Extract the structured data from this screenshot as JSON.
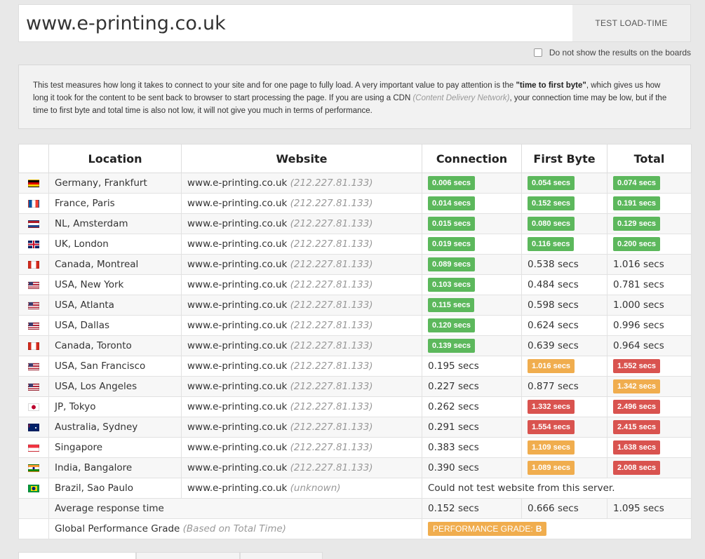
{
  "search": {
    "url_value": "www.e-printing.co.uk",
    "button_label": "TEST LOAD-TIME"
  },
  "options": {
    "hide_label": "Do not show the results on the boards"
  },
  "info": {
    "part1": "This test measures how long it takes to connect to your site and for one page to fully load. A very important value to pay attention is the ",
    "bold": "\"time to first byte\"",
    "part2": ", which gives us how long it took for the content to be sent back to browser to start processing the page. If you are using a CDN ",
    "cdn": "(Content Delivery Network)",
    "part3": ", your connection time may be low, but if the time to first byte and total time is also not low, it will not give you much in terms of performance."
  },
  "table": {
    "headers": [
      "Location",
      "Website",
      "Connection",
      "First Byte",
      "Total"
    ],
    "rows": [
      {
        "flag": "de",
        "location": "Germany, Frankfurt",
        "website": "www.e-printing.co.uk",
        "ip": "(212.227.81.133)",
        "connection": {
          "text": "0.006 secs",
          "status": "green"
        },
        "first_byte": {
          "text": "0.054 secs",
          "status": "green"
        },
        "total": {
          "text": "0.074 secs",
          "status": "green"
        }
      },
      {
        "flag": "fr",
        "location": "France, Paris",
        "website": "www.e-printing.co.uk",
        "ip": "(212.227.81.133)",
        "connection": {
          "text": "0.014 secs",
          "status": "green"
        },
        "first_byte": {
          "text": "0.152 secs",
          "status": "green"
        },
        "total": {
          "text": "0.191 secs",
          "status": "green"
        }
      },
      {
        "flag": "nl",
        "location": "NL, Amsterdam",
        "website": "www.e-printing.co.uk",
        "ip": "(212.227.81.133)",
        "connection": {
          "text": "0.015 secs",
          "status": "green"
        },
        "first_byte": {
          "text": "0.080 secs",
          "status": "green"
        },
        "total": {
          "text": "0.129 secs",
          "status": "green"
        }
      },
      {
        "flag": "uk",
        "location": "UK, London",
        "website": "www.e-printing.co.uk",
        "ip": "(212.227.81.133)",
        "connection": {
          "text": "0.019 secs",
          "status": "green"
        },
        "first_byte": {
          "text": "0.116 secs",
          "status": "green"
        },
        "total": {
          "text": "0.200 secs",
          "status": "green"
        }
      },
      {
        "flag": "ca",
        "location": "Canada, Montreal",
        "website": "www.e-printing.co.uk",
        "ip": "(212.227.81.133)",
        "connection": {
          "text": "0.089 secs",
          "status": "green"
        },
        "first_byte": {
          "text": "0.538 secs",
          "status": "plain"
        },
        "total": {
          "text": "1.016 secs",
          "status": "plain"
        }
      },
      {
        "flag": "us",
        "location": "USA, New York",
        "website": "www.e-printing.co.uk",
        "ip": "(212.227.81.133)",
        "connection": {
          "text": "0.103 secs",
          "status": "green"
        },
        "first_byte": {
          "text": "0.484 secs",
          "status": "plain"
        },
        "total": {
          "text": "0.781 secs",
          "status": "plain"
        }
      },
      {
        "flag": "us",
        "location": "USA, Atlanta",
        "website": "www.e-printing.co.uk",
        "ip": "(212.227.81.133)",
        "connection": {
          "text": "0.115 secs",
          "status": "green"
        },
        "first_byte": {
          "text": "0.598 secs",
          "status": "plain"
        },
        "total": {
          "text": "1.000 secs",
          "status": "plain"
        }
      },
      {
        "flag": "us",
        "location": "USA, Dallas",
        "website": "www.e-printing.co.uk",
        "ip": "(212.227.81.133)",
        "connection": {
          "text": "0.120 secs",
          "status": "green"
        },
        "first_byte": {
          "text": "0.624 secs",
          "status": "plain"
        },
        "total": {
          "text": "0.996 secs",
          "status": "plain"
        }
      },
      {
        "flag": "ca",
        "location": "Canada, Toronto",
        "website": "www.e-printing.co.uk",
        "ip": "(212.227.81.133)",
        "connection": {
          "text": "0.139 secs",
          "status": "green"
        },
        "first_byte": {
          "text": "0.639 secs",
          "status": "plain"
        },
        "total": {
          "text": "0.964 secs",
          "status": "plain"
        }
      },
      {
        "flag": "us",
        "location": "USA, San Francisco",
        "website": "www.e-printing.co.uk",
        "ip": "(212.227.81.133)",
        "connection": {
          "text": "0.195 secs",
          "status": "plain"
        },
        "first_byte": {
          "text": "1.016 secs",
          "status": "orange"
        },
        "total": {
          "text": "1.552 secs",
          "status": "red"
        }
      },
      {
        "flag": "us",
        "location": "USA, Los Angeles",
        "website": "www.e-printing.co.uk",
        "ip": "(212.227.81.133)",
        "connection": {
          "text": "0.227 secs",
          "status": "plain"
        },
        "first_byte": {
          "text": "0.877 secs",
          "status": "plain"
        },
        "total": {
          "text": "1.342 secs",
          "status": "orange"
        }
      },
      {
        "flag": "jp",
        "location": "JP, Tokyo",
        "website": "www.e-printing.co.uk",
        "ip": "(212.227.81.133)",
        "connection": {
          "text": "0.262 secs",
          "status": "plain"
        },
        "first_byte": {
          "text": "1.332 secs",
          "status": "red"
        },
        "total": {
          "text": "2.496 secs",
          "status": "red"
        }
      },
      {
        "flag": "au",
        "location": "Australia, Sydney",
        "website": "www.e-printing.co.uk",
        "ip": "(212.227.81.133)",
        "connection": {
          "text": "0.291 secs",
          "status": "plain"
        },
        "first_byte": {
          "text": "1.554 secs",
          "status": "red"
        },
        "total": {
          "text": "2.415 secs",
          "status": "red"
        }
      },
      {
        "flag": "sg",
        "location": "Singapore",
        "website": "www.e-printing.co.uk",
        "ip": "(212.227.81.133)",
        "connection": {
          "text": "0.383 secs",
          "status": "plain"
        },
        "first_byte": {
          "text": "1.109 secs",
          "status": "orange"
        },
        "total": {
          "text": "1.638 secs",
          "status": "red"
        }
      },
      {
        "flag": "in",
        "location": "India, Bangalore",
        "website": "www.e-printing.co.uk",
        "ip": "(212.227.81.133)",
        "connection": {
          "text": "0.390 secs",
          "status": "plain"
        },
        "first_byte": {
          "text": "1.089 secs",
          "status": "orange"
        },
        "total": {
          "text": "2.008 secs",
          "status": "red"
        }
      }
    ],
    "brazil": {
      "flag": "br",
      "location": "Brazil, Sao Paulo",
      "website": "www.e-printing.co.uk",
      "ip": "(unknown)",
      "message": "Could not test website from this server."
    },
    "average": {
      "label": "Average response time",
      "connection": "0.152 secs",
      "first_byte": "0.666 secs",
      "total": "1.095 secs"
    },
    "grade": {
      "label": "Global Performance Grade",
      "note": "(Based on Total Time)",
      "badge_label": "PERFORMANCE GRADE:",
      "badge_value": "B"
    }
  },
  "colors": {
    "green": "#5cb85c",
    "orange": "#f0ad4e",
    "red": "#d9534f"
  }
}
